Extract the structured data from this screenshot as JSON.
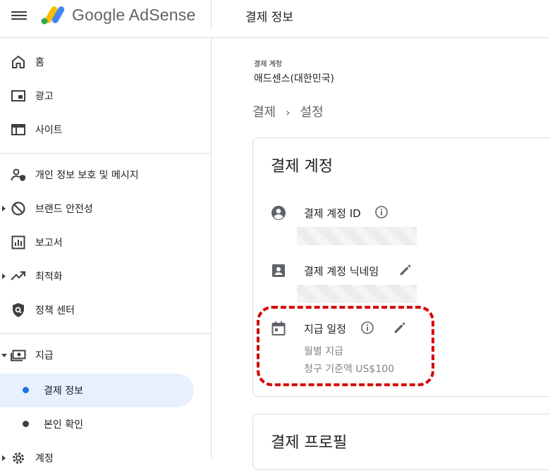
{
  "header": {
    "brand": "Google AdSense",
    "page_title": "결제 정보"
  },
  "sidebar": {
    "items": [
      {
        "label": "홈",
        "icon": "home-icon"
      },
      {
        "label": "광고",
        "icon": "ads-icon"
      },
      {
        "label": "사이트",
        "icon": "sites-icon"
      },
      {
        "label": "개인 정보 보호 및 메시지",
        "icon": "privacy-icon"
      },
      {
        "label": "브랜드 안전성",
        "icon": "block-icon"
      },
      {
        "label": "보고서",
        "icon": "reports-icon"
      },
      {
        "label": "최적화",
        "icon": "trending-icon"
      },
      {
        "label": "정책 센터",
        "icon": "policy-icon"
      },
      {
        "label": "지급",
        "icon": "payments-icon"
      },
      {
        "label": "계정",
        "icon": "gear-icon"
      }
    ],
    "sub_items": [
      {
        "label": "결제 정보",
        "active": true
      },
      {
        "label": "본인 확인",
        "active": false
      }
    ]
  },
  "main": {
    "account_label": "결제 계정",
    "account_value": "애드센스(대한민국)",
    "breadcrumb": [
      "결제",
      "설정"
    ],
    "card1": {
      "title": "결제 계정",
      "rows": [
        {
          "label": "결제 계정 ID",
          "icon": "account-circle-icon"
        },
        {
          "label": "결제 계정 닉네임",
          "icon": "contact-card-icon"
        },
        {
          "label": "지급 일정",
          "icon": "calendar-icon",
          "lines": [
            "월별 지급",
            "청구 기준액 US$100"
          ]
        }
      ]
    },
    "card2": {
      "title": "결제 프로필"
    }
  },
  "colors": {
    "accent": "#1a73e8",
    "active_bg": "#e8f0fe",
    "highlight": "#d50000"
  }
}
